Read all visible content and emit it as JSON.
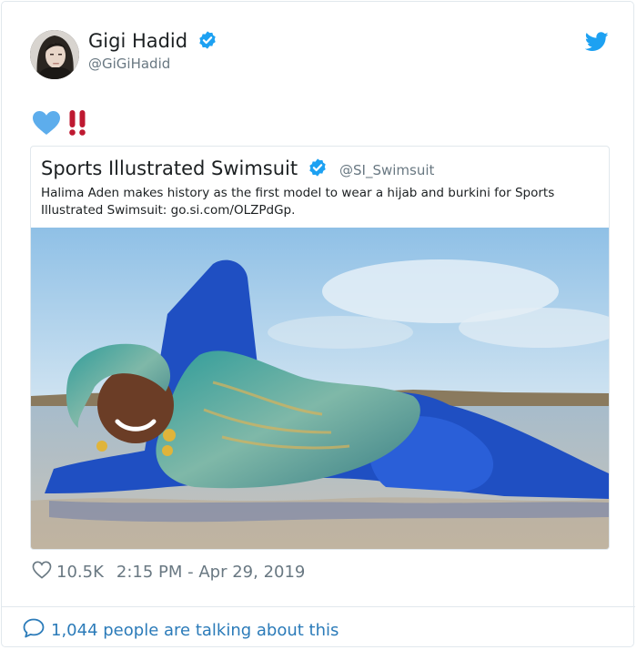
{
  "tweet": {
    "display_name": "Gigi Hadid",
    "handle": "@GiGiHadid",
    "verified": true,
    "emoji": [
      "blue-heart",
      "double-exclamation"
    ],
    "likes": "10.5K",
    "timestamp": "2:15 PM - Apr 29, 2019"
  },
  "quoted_tweet": {
    "display_name": "Sports Illustrated Swimsuit",
    "handle": "@SI_Swimsuit",
    "verified": true,
    "text": "Halima Aden makes history as the first model to wear a hijab and burkini for Sports Illustrated Swimsuit: go.si.com/OLZPdGp."
  },
  "footer": {
    "talking_text": "1,044 people are talking about this"
  },
  "colors": {
    "verified_blue": "#1da1f2",
    "link_blue": "#2b7bb9",
    "secondary_text": "#697882",
    "border": "#e1e8ed",
    "heart_emoji": "#5dadec",
    "exclamation": "#be1931"
  }
}
